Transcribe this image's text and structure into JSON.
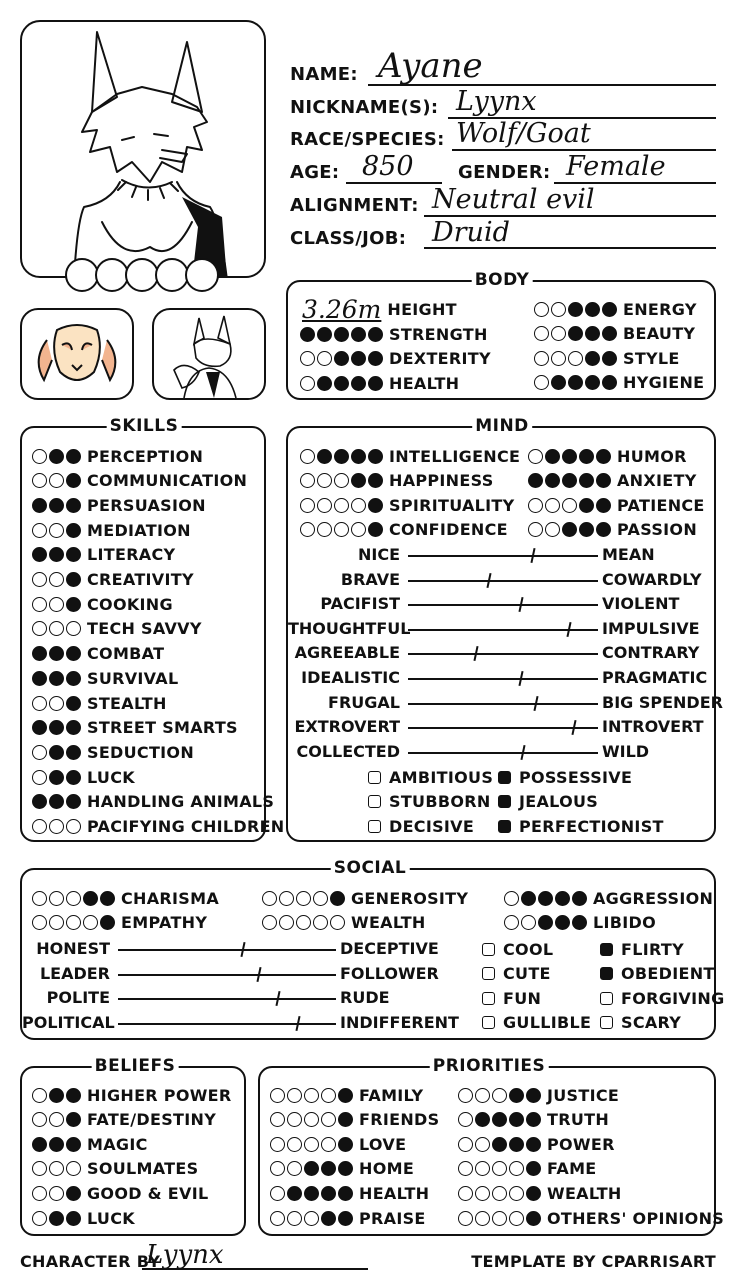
{
  "identity": {
    "name_label": "NAME:",
    "name": "Ayane",
    "nickname_label": "NICKNAME(S):",
    "nickname": "Lyynx",
    "race_label": "RACE/SPECIES:",
    "race": "Wolf/Goat",
    "age_label": "AGE:",
    "age": "850",
    "gender_label": "GENDER:",
    "gender": "Female",
    "alignment_label": "ALIGNMENT:",
    "alignment": "Neutral evil",
    "class_label": "CLASS/JOB:",
    "class": "Druid"
  },
  "body": {
    "title": "BODY",
    "height_value": "3.26m",
    "height_label": "HEIGHT",
    "stats_left": [
      {
        "label": "STRENGTH",
        "filled": 5,
        "total": 5
      },
      {
        "label": "DEXTERITY",
        "filled": 3,
        "total": 5
      },
      {
        "label": "HEALTH",
        "filled": 4,
        "total": 5
      }
    ],
    "stats_right": [
      {
        "label": "ENERGY",
        "filled": 3,
        "total": 5
      },
      {
        "label": "BEAUTY",
        "filled": 3,
        "total": 5
      },
      {
        "label": "STYLE",
        "filled": 2,
        "total": 5
      },
      {
        "label": "HYGIENE",
        "filled": 4,
        "total": 5
      }
    ]
  },
  "skills": {
    "title": "SKILLS",
    "items": [
      {
        "label": "PERCEPTION",
        "filled": 2
      },
      {
        "label": "COMMUNICATION",
        "filled": 1
      },
      {
        "label": "PERSUASION",
        "filled": 3
      },
      {
        "label": "MEDIATION",
        "filled": 1
      },
      {
        "label": "LITERACY",
        "filled": 3
      },
      {
        "label": "CREATIVITY",
        "filled": 1
      },
      {
        "label": "COOKING",
        "filled": 1
      },
      {
        "label": "TECH SAVVY",
        "filled": 0
      },
      {
        "label": "COMBAT",
        "filled": 3
      },
      {
        "label": "SURVIVAL",
        "filled": 3
      },
      {
        "label": "STEALTH",
        "filled": 1
      },
      {
        "label": "STREET SMARTS",
        "filled": 3
      },
      {
        "label": "SEDUCTION",
        "filled": 2
      },
      {
        "label": "LUCK",
        "filled": 2
      },
      {
        "label": "HANDLING ANIMALS",
        "filled": 3
      },
      {
        "label": "PACIFYING CHILDREN",
        "filled": 0
      }
    ]
  },
  "mind": {
    "title": "MIND",
    "stats_left": [
      {
        "label": "INTELLIGENCE",
        "filled": 4
      },
      {
        "label": "HAPPINESS",
        "filled": 2
      },
      {
        "label": "SPIRITUALITY",
        "filled": 1
      },
      {
        "label": "CONFIDENCE",
        "filled": 1
      }
    ],
    "stats_right": [
      {
        "label": "HUMOR",
        "filled": 4
      },
      {
        "label": "ANXIETY",
        "filled": 5
      },
      {
        "label": "PATIENCE",
        "filled": 2
      },
      {
        "label": "PASSION",
        "filled": 3
      }
    ],
    "sliders": [
      {
        "left": "NICE",
        "right": "MEAN",
        "value": 0.65
      },
      {
        "left": "BRAVE",
        "right": "COWARDLY",
        "value": 0.42
      },
      {
        "left": "PACIFIST",
        "right": "VIOLENT",
        "value": 0.59
      },
      {
        "left": "THOUGHTFUL",
        "right": "IMPULSIVE",
        "value": 0.84
      },
      {
        "left": "AGREEABLE",
        "right": "CONTRARY",
        "value": 0.35
      },
      {
        "left": "IDEALISTIC",
        "right": "PRAGMATIC",
        "value": 0.59
      },
      {
        "left": "FRUGAL",
        "right": "BIG SPENDER",
        "value": 0.67
      },
      {
        "left": "EXTROVERT",
        "right": "INTROVERT",
        "value": 0.87
      },
      {
        "left": "COLLECTED",
        "right": "WILD",
        "value": 0.6
      }
    ],
    "checks": [
      {
        "label": "AMBITIOUS",
        "checked": false
      },
      {
        "label": "POSSESSIVE",
        "checked": true
      },
      {
        "label": "STUBBORN",
        "checked": false
      },
      {
        "label": "JEALOUS",
        "checked": true
      },
      {
        "label": "DECISIVE",
        "checked": false
      },
      {
        "label": "PERFECTIONIST",
        "checked": true
      }
    ]
  },
  "social": {
    "title": "SOCIAL",
    "stats": [
      {
        "label": "CHARISMA",
        "filled": 2
      },
      {
        "label": "GENEROSITY",
        "filled": 1
      },
      {
        "label": "AGGRESSION",
        "filled": 4
      },
      {
        "label": "EMPATHY",
        "filled": 1
      },
      {
        "label": "WEALTH",
        "filled": 0
      },
      {
        "label": "LIBIDO",
        "filled": 3
      }
    ],
    "sliders": [
      {
        "left": "HONEST",
        "right": "DECEPTIVE",
        "value": 0.57
      },
      {
        "left": "LEADER",
        "right": "FOLLOWER",
        "value": 0.64
      },
      {
        "left": "POLITE",
        "right": "RUDE",
        "value": 0.73
      },
      {
        "left": "POLITICAL",
        "right": "INDIFFERENT",
        "value": 0.82
      }
    ],
    "checks": [
      {
        "label": "COOL",
        "checked": false
      },
      {
        "label": "FLIRTY",
        "checked": true
      },
      {
        "label": "CUTE",
        "checked": false
      },
      {
        "label": "OBEDIENT",
        "checked": true
      },
      {
        "label": "FUN",
        "checked": false
      },
      {
        "label": "FORGIVING",
        "checked": false
      },
      {
        "label": "GULLIBLE",
        "checked": false
      },
      {
        "label": "SCARY",
        "checked": false
      }
    ]
  },
  "beliefs": {
    "title": "BELIEFS",
    "items": [
      {
        "label": "HIGHER POWER",
        "filled": 2
      },
      {
        "label": "FATE/DESTINY",
        "filled": 1
      },
      {
        "label": "MAGIC",
        "filled": 3
      },
      {
        "label": "SOULMATES",
        "filled": 0
      },
      {
        "label": "GOOD & EVIL",
        "filled": 1
      },
      {
        "label": "LUCK",
        "filled": 2
      }
    ]
  },
  "priorities": {
    "title": "PRIORITIES",
    "left": [
      {
        "label": "FAMILY",
        "filled": 1
      },
      {
        "label": "FRIENDS",
        "filled": 1
      },
      {
        "label": "LOVE",
        "filled": 1
      },
      {
        "label": "HOME",
        "filled": 3
      },
      {
        "label": "HEALTH",
        "filled": 4
      },
      {
        "label": "PRAISE",
        "filled": 2
      }
    ],
    "right": [
      {
        "label": "JUSTICE",
        "filled": 2
      },
      {
        "label": "TRUTH",
        "filled": 4
      },
      {
        "label": "POWER",
        "filled": 3
      },
      {
        "label": "FAME",
        "filled": 1
      },
      {
        "label": "WEALTH",
        "filled": 1
      },
      {
        "label": "OTHERS' OPINIONS",
        "filled": 1
      }
    ]
  },
  "footer": {
    "character_by_label": "CHARACTER BY",
    "character_by": "Lyynx",
    "template_by": "TEMPLATE BY CPARRISART"
  }
}
